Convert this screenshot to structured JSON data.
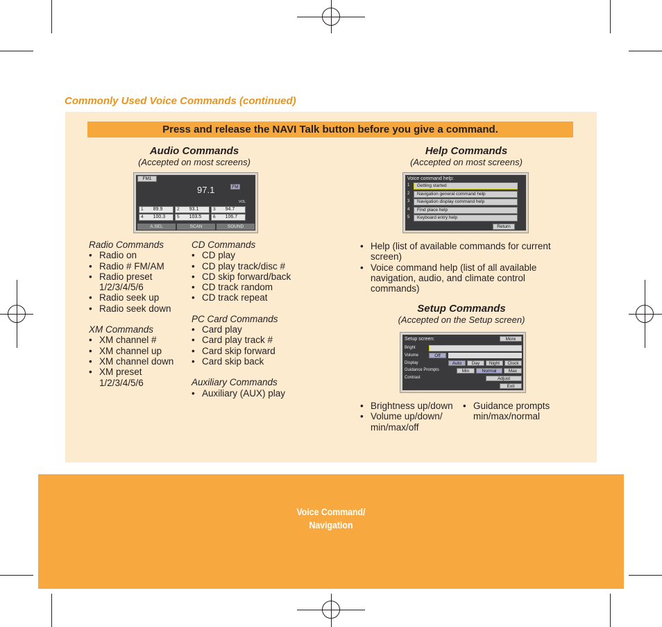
{
  "section_title": "Commonly Used Voice Commands (continued)",
  "banner": "Press and release the NAVI Talk button before you give a command.",
  "audio": {
    "heading": "Audio Commands",
    "sub": "(Accepted on most screens)",
    "screen": {
      "band": "FM1",
      "freq": "97.1",
      "presets": [
        [
          "1",
          "89.9"
        ],
        [
          "2",
          "93.1"
        ],
        [
          "3",
          "94.7"
        ],
        [
          "4",
          "100.3"
        ],
        [
          "5",
          "103.5"
        ],
        [
          "6",
          "106.7"
        ]
      ],
      "buttons": [
        "A.SEL",
        "SCAN",
        "SOUND"
      ],
      "fm": "FM",
      "vol": "VOL"
    },
    "groups_left": [
      {
        "title": "Radio Commands",
        "items": [
          "Radio on",
          "Radio # FM/AM",
          "Radio preset 1/2/3/4/5/6",
          "Radio seek up",
          "Radio seek down"
        ]
      },
      {
        "title": "XM Commands",
        "items": [
          "XM channel #",
          "XM channel up",
          "XM channel down",
          "XM preset 1/2/3/4/5/6"
        ]
      }
    ],
    "groups_right": [
      {
        "title": "CD Commands",
        "items": [
          "CD play",
          "CD play track/disc #",
          "CD skip forward/back",
          "CD track random",
          "CD track repeat"
        ]
      },
      {
        "title": "PC Card Commands",
        "items": [
          "Card play",
          "Card play track #",
          "Card skip forward",
          "Card skip back"
        ]
      },
      {
        "title": "Auxiliary Commands",
        "items": [
          "Auxiliary (AUX) play"
        ]
      }
    ]
  },
  "help": {
    "heading": "Help Commands",
    "sub": "(Accepted on most screens)",
    "screen": {
      "title": "Voice command help:",
      "items": [
        "Getting started",
        "Navigation general command help",
        "Navigation display command help",
        "Find place help",
        "Keyboard entry help"
      ],
      "return": "Return"
    },
    "items": [
      "Help (list of available commands for current screen)",
      "Voice command help (list of all available navigation, audio, and climate control commands)"
    ]
  },
  "setup": {
    "heading": "Setup Commands",
    "sub": "(Accepted on the Setup screen)",
    "screen": {
      "title": "Setup screen:",
      "more": "More",
      "rows": [
        "Bright",
        "Volume",
        "Display",
        "Guidance Prompts",
        "Contrast"
      ],
      "off": "Off",
      "display": [
        "Auto",
        "Day",
        "Night",
        "Clock"
      ],
      "prompts": [
        "Min",
        "Normal",
        "Max"
      ],
      "adjust": "Adjust",
      "exit": "Exit"
    },
    "items_left": [
      "Brightness up/down",
      "Volume up/down/ min/max/off"
    ],
    "items_right": [
      "Guidance prompts min/max/normal"
    ]
  },
  "footer": {
    "line1": "Voice Command/",
    "line2": "Navigation"
  },
  "colors": {
    "accent": "#f7a83c",
    "heading": "#e8951e",
    "panel": "#fdebd0"
  }
}
